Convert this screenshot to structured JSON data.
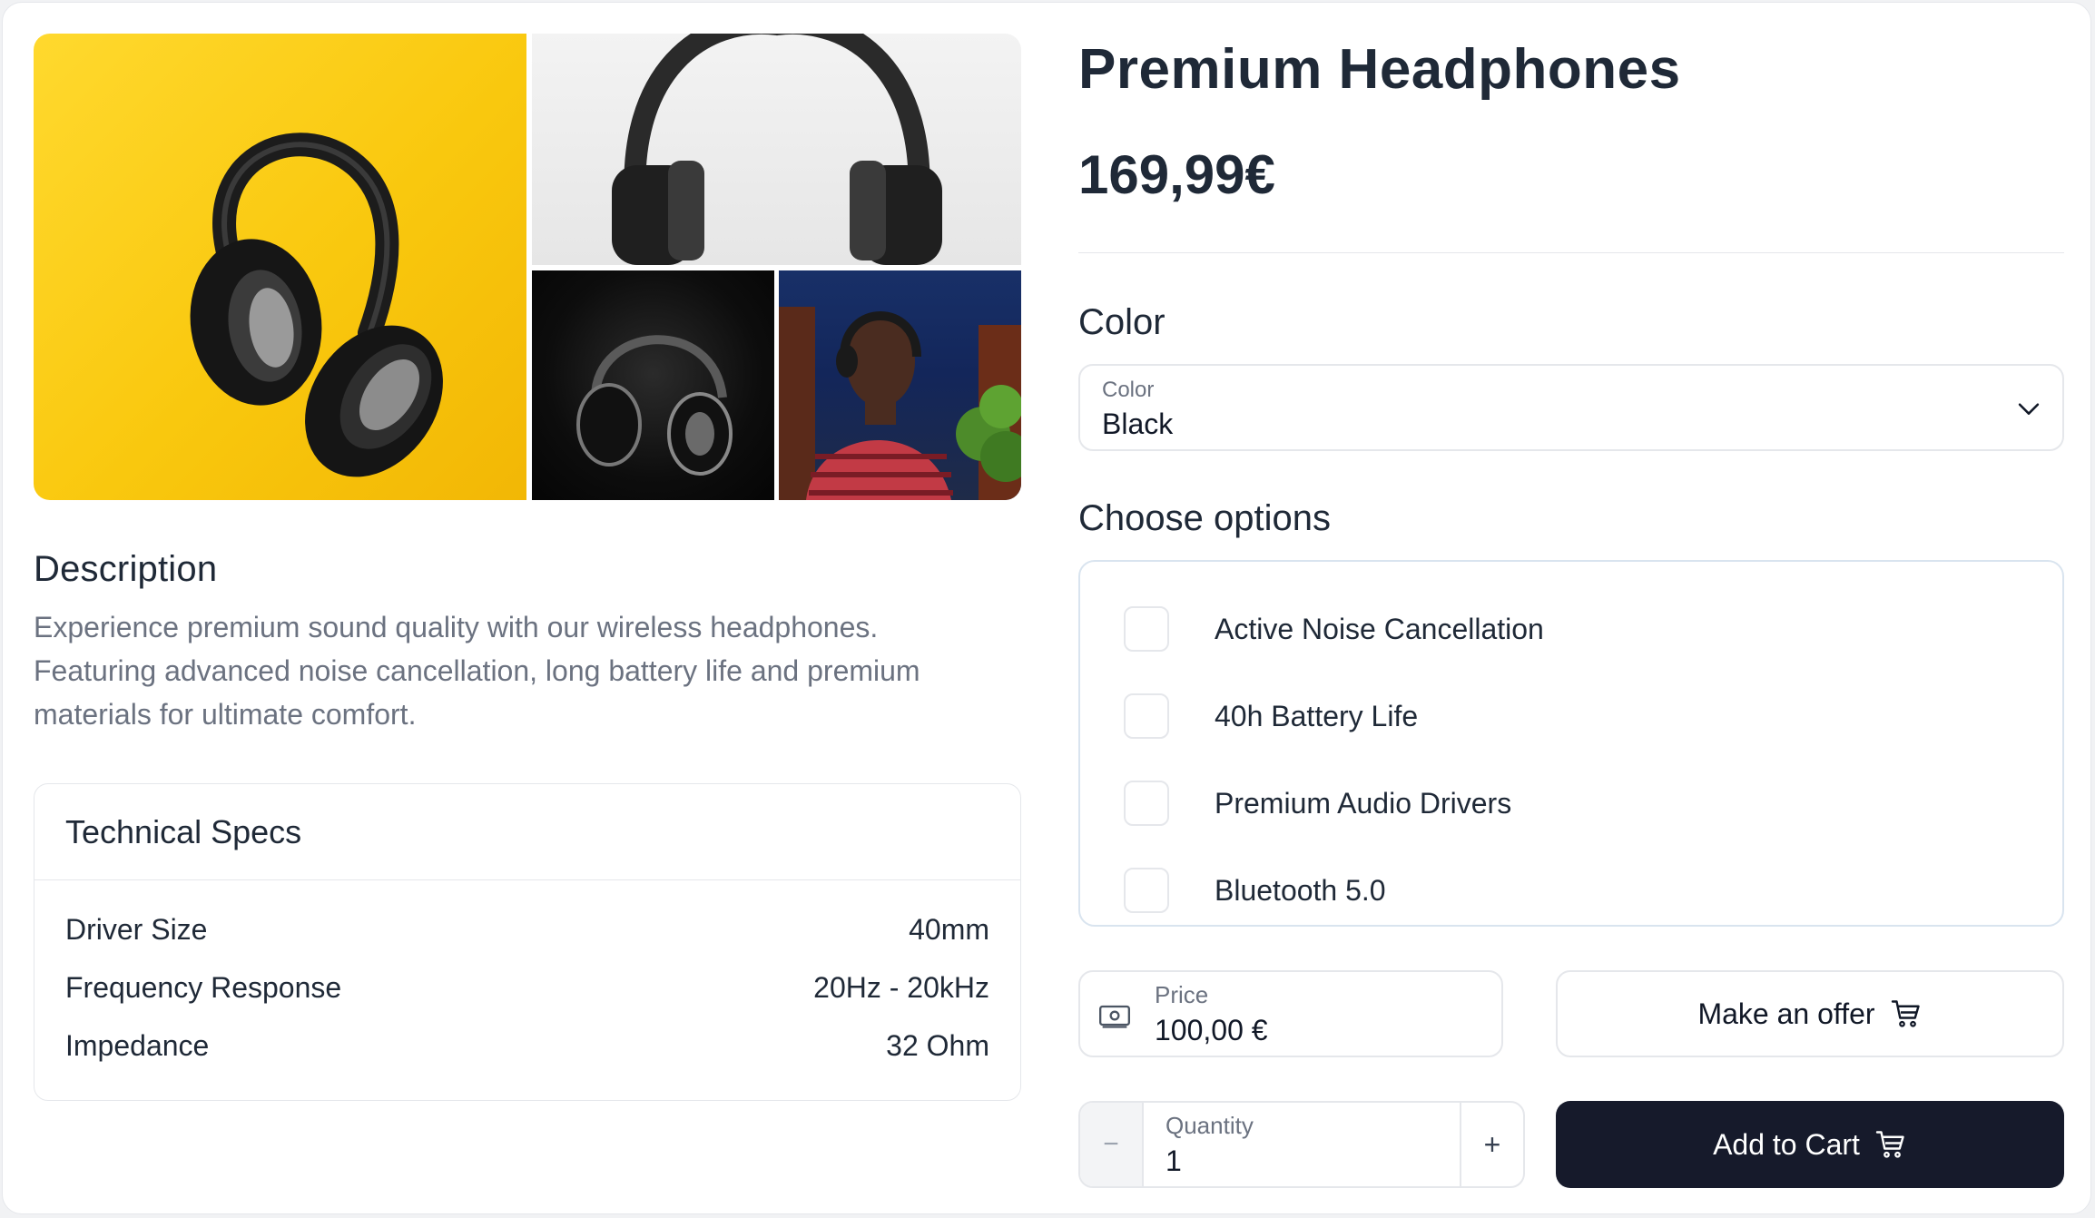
{
  "product": {
    "title": "Premium Headphones",
    "price": "169,99€"
  },
  "gallery": {
    "images": [
      {
        "name": "headphones on yellow background"
      },
      {
        "name": "headphones on white background"
      },
      {
        "name": "headphones on black background"
      },
      {
        "name": "man wearing headphones"
      }
    ]
  },
  "description": {
    "title": "Description",
    "text": "Experience premium sound quality with our wireless headphones. Featuring advanced noise cancellation, long battery life and premium materials for ultimate comfort."
  },
  "specs": {
    "title": "Technical Specs",
    "rows": [
      {
        "label": "Driver Size",
        "value": "40mm"
      },
      {
        "label": "Frequency Response",
        "value": "20Hz - 20kHz"
      },
      {
        "label": "Impedance",
        "value": "32 Ohm"
      }
    ]
  },
  "color": {
    "label": "Color",
    "select_label": "Color",
    "selected": "Black",
    "icon": "chevron-down-icon"
  },
  "options": {
    "label": "Choose options",
    "items": [
      {
        "label": "Active Noise Cancellation",
        "checked": false
      },
      {
        "label": "40h Battery Life",
        "checked": false
      },
      {
        "label": "Premium Audio Drivers",
        "checked": false
      },
      {
        "label": "Bluetooth 5.0",
        "checked": false
      }
    ]
  },
  "offer": {
    "price_label": "Price",
    "price_value": "100,00 €",
    "button_label": "Make an offer",
    "icon": "cart-icon"
  },
  "quantity": {
    "label": "Quantity",
    "value": "1",
    "minus": "−",
    "plus": "+"
  },
  "cart": {
    "button_label": "Add to Cart",
    "icon": "cart-icon"
  },
  "colors": {
    "primary_button": "#161a2b",
    "border": "#e5e7eb",
    "muted_text": "#6b7280"
  }
}
